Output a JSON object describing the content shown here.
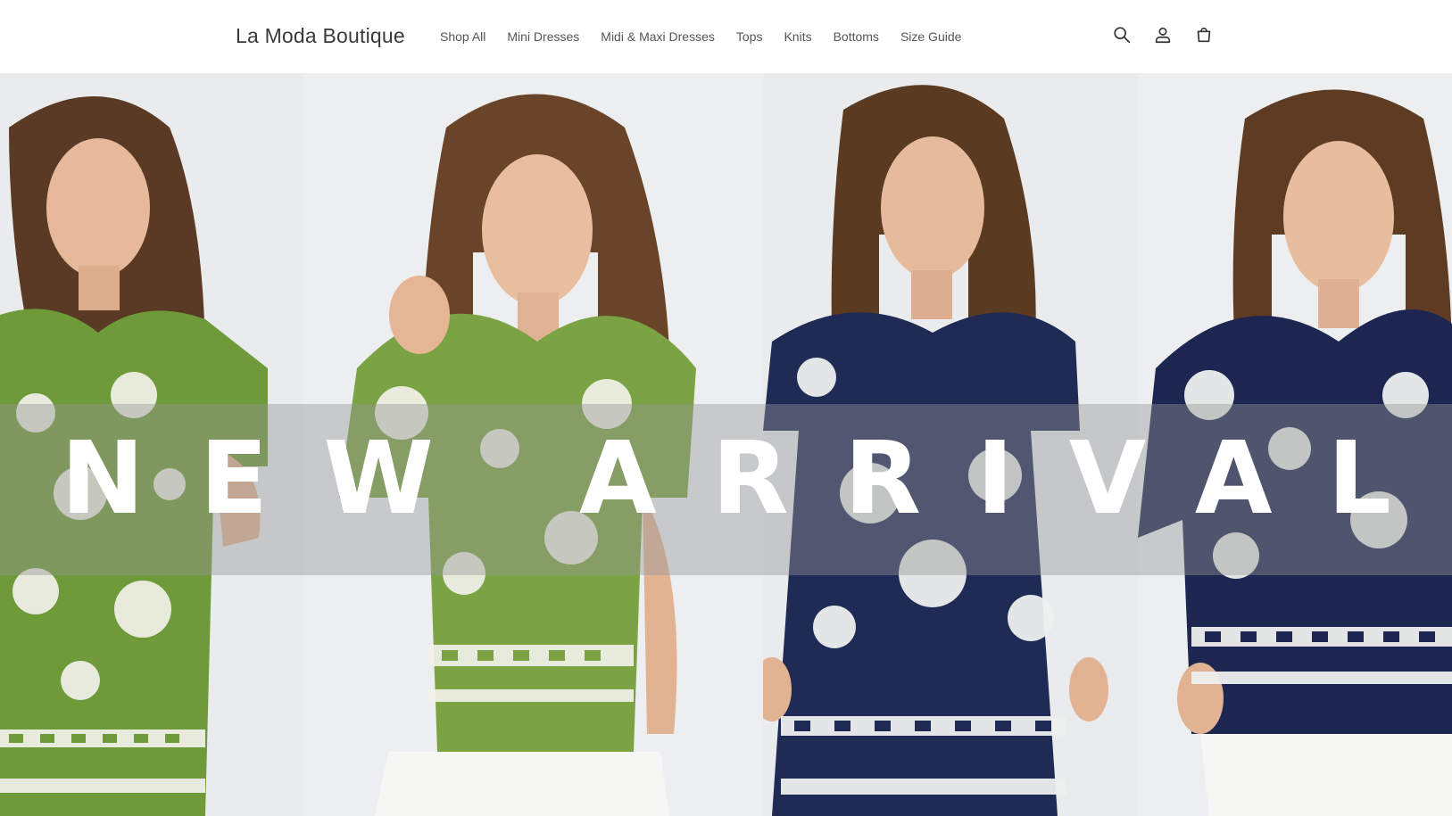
{
  "header": {
    "logo": "La Moda Boutique",
    "nav": [
      {
        "label": "Shop All"
      },
      {
        "label": "Mini Dresses"
      },
      {
        "label": "Midi & Maxi Dresses"
      },
      {
        "label": "Tops"
      },
      {
        "label": "Knits"
      },
      {
        "label": "Bottoms"
      },
      {
        "label": "Size Guide"
      }
    ],
    "icons": [
      "search-icon",
      "account-icon",
      "cart-icon"
    ]
  },
  "hero": {
    "banner_text": "NEW ARRIVAL",
    "panels": [
      {
        "name": "model-green-dress",
        "garment_color": "#6e9a3a"
      },
      {
        "name": "model-green-shirt",
        "garment_color": "#7ba344"
      },
      {
        "name": "model-navy-dress",
        "garment_color": "#1f2a55"
      },
      {
        "name": "model-navy-shirt",
        "garment_color": "#1c2650"
      }
    ]
  },
  "colors": {
    "text": "#3a3a3a",
    "nav_text": "#555555",
    "banner_text": "#ffffff",
    "banner_overlay": "rgba(150,150,150,0.42)",
    "green_print": "#6e9a3a",
    "navy_print": "#1f2a55"
  }
}
